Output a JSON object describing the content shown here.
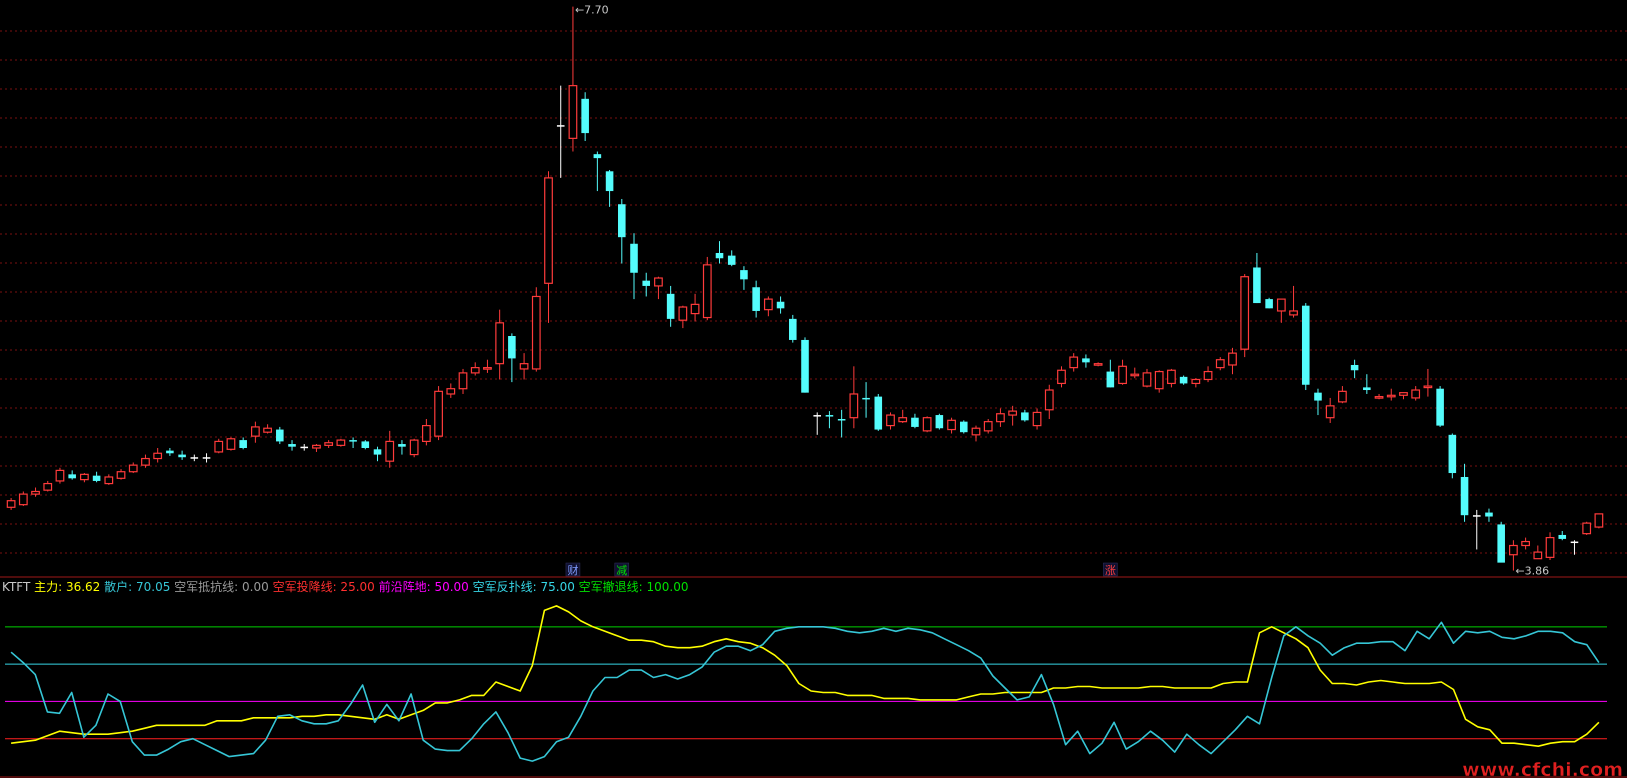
{
  "indicator": {
    "name": "KTFT",
    "items": [
      {
        "label": "主力:",
        "value": "36.62",
        "color": "#ffff00"
      },
      {
        "label": "散户:",
        "value": "70.05",
        "color": "#36c6d6"
      },
      {
        "label": "空军抵抗线:",
        "value": "0.00",
        "color": "#9a9a9a"
      },
      {
        "label": "空军投降线:",
        "value": "25.00",
        "color": "#ff3030"
      },
      {
        "label": "前沿阵地:",
        "value": "50.00",
        "color": "#ff00ff"
      },
      {
        "label": "空军反扑线:",
        "value": "75.00",
        "color": "#36d6e6"
      },
      {
        "label": "空军撤退线:",
        "value": "100.00",
        "color": "#00e000"
      }
    ]
  },
  "markers": [
    {
      "text": "财",
      "color": "#7f9cff"
    },
    {
      "text": "减",
      "color": "#00e000"
    },
    {
      "text": "涨",
      "color": "#ff4040"
    }
  ],
  "price_labels": {
    "high": "7.70",
    "low": "3.86"
  },
  "watermark": "www.cfchi.com",
  "colors": {
    "up": "#ff3b3b",
    "down": "#54fcfc",
    "doji": "#ffffff",
    "grid": "#7a1010",
    "bg": "#000000"
  },
  "chart_data": [
    {
      "type": "candlestick",
      "ylim": [
        3.5,
        7.75
      ],
      "candles": [
        [
          3.9,
          3.97,
          3.88,
          3.95
        ],
        [
          3.92,
          4.02,
          3.91,
          4.0
        ],
        [
          4.0,
          4.05,
          3.98,
          4.02
        ],
        [
          4.03,
          4.1,
          4.02,
          4.08
        ],
        [
          4.1,
          4.2,
          4.08,
          4.18
        ],
        [
          4.15,
          4.18,
          4.11,
          4.12
        ],
        [
          4.11,
          4.16,
          4.09,
          4.15
        ],
        [
          4.14,
          4.17,
          4.09,
          4.1
        ],
        [
          4.08,
          4.15,
          4.07,
          4.13
        ],
        [
          4.12,
          4.19,
          4.11,
          4.17
        ],
        [
          4.17,
          4.24,
          4.16,
          4.22
        ],
        [
          4.22,
          4.3,
          4.2,
          4.27
        ],
        [
          4.27,
          4.35,
          4.24,
          4.31
        ],
        [
          4.33,
          4.35,
          4.29,
          4.31
        ],
        [
          4.3,
          4.33,
          4.26,
          4.28
        ],
        [
          4.28,
          4.3,
          4.25,
          4.28
        ],
        [
          4.28,
          4.31,
          4.24,
          4.28
        ],
        [
          4.32,
          4.42,
          4.31,
          4.4
        ],
        [
          4.34,
          4.43,
          4.33,
          4.42
        ],
        [
          4.41,
          4.43,
          4.34,
          4.35
        ],
        [
          4.44,
          4.55,
          4.39,
          4.51
        ],
        [
          4.47,
          4.53,
          4.46,
          4.5
        ],
        [
          4.49,
          4.51,
          4.38,
          4.4
        ],
        [
          4.38,
          4.41,
          4.33,
          4.36
        ],
        [
          4.36,
          4.38,
          4.33,
          4.36
        ],
        [
          4.35,
          4.38,
          4.32,
          4.37
        ],
        [
          4.37,
          4.41,
          4.35,
          4.39
        ],
        [
          4.37,
          4.42,
          4.36,
          4.41
        ],
        [
          4.41,
          4.43,
          4.35,
          4.4
        ],
        [
          4.4,
          4.41,
          4.34,
          4.35
        ],
        [
          4.34,
          4.36,
          4.25,
          4.3
        ],
        [
          4.25,
          4.48,
          4.2,
          4.4
        ],
        [
          4.38,
          4.41,
          4.3,
          4.36
        ],
        [
          4.3,
          4.42,
          4.28,
          4.41
        ],
        [
          4.4,
          4.57,
          4.37,
          4.52
        ],
        [
          4.44,
          4.82,
          4.41,
          4.78
        ],
        [
          4.76,
          4.84,
          4.73,
          4.8
        ],
        [
          4.8,
          4.95,
          4.76,
          4.92
        ],
        [
          4.92,
          5.0,
          4.9,
          4.96
        ],
        [
          4.95,
          5.02,
          4.92,
          4.96
        ],
        [
          4.99,
          5.4,
          4.87,
          5.3
        ],
        [
          5.2,
          5.22,
          4.85,
          5.03
        ],
        [
          4.95,
          5.07,
          4.87,
          4.99
        ],
        [
          4.95,
          5.57,
          4.93,
          5.5
        ],
        [
          5.6,
          6.45,
          5.3,
          6.4
        ],
        [
          6.8,
          7.1,
          6.4,
          6.8
        ],
        [
          6.7,
          7.7,
          6.6,
          7.1
        ],
        [
          7.0,
          7.05,
          6.68,
          6.74
        ],
        [
          6.58,
          6.6,
          6.3,
          6.55
        ],
        [
          6.45,
          6.46,
          6.18,
          6.3
        ],
        [
          6.2,
          6.24,
          5.75,
          5.95
        ],
        [
          5.9,
          5.98,
          5.48,
          5.68
        ],
        [
          5.62,
          5.68,
          5.5,
          5.58
        ],
        [
          5.58,
          5.65,
          5.48,
          5.64
        ],
        [
          5.52,
          5.58,
          5.27,
          5.33
        ],
        [
          5.32,
          5.43,
          5.26,
          5.42
        ],
        [
          5.37,
          5.52,
          5.31,
          5.44
        ],
        [
          5.34,
          5.8,
          5.32,
          5.74
        ],
        [
          5.83,
          5.92,
          5.75,
          5.79
        ],
        [
          5.81,
          5.85,
          5.73,
          5.74
        ],
        [
          5.7,
          5.73,
          5.55,
          5.63
        ],
        [
          5.57,
          5.62,
          5.34,
          5.39
        ],
        [
          5.4,
          5.5,
          5.35,
          5.48
        ],
        [
          5.46,
          5.5,
          5.37,
          5.41
        ],
        [
          5.33,
          5.36,
          5.15,
          5.17
        ],
        [
          5.17,
          5.19,
          4.77,
          4.77
        ],
        [
          4.6,
          4.62,
          4.45,
          4.6
        ],
        [
          4.6,
          4.63,
          4.5,
          4.59
        ],
        [
          4.57,
          4.64,
          4.43,
          4.56
        ],
        [
          4.58,
          4.97,
          4.5,
          4.76
        ],
        [
          4.73,
          4.85,
          4.58,
          4.72
        ],
        [
          4.74,
          4.76,
          4.48,
          4.49
        ],
        [
          4.52,
          4.62,
          4.49,
          4.6
        ],
        [
          4.55,
          4.64,
          4.54,
          4.58
        ],
        [
          4.58,
          4.61,
          4.5,
          4.51
        ],
        [
          4.48,
          4.59,
          4.47,
          4.58
        ],
        [
          4.6,
          4.61,
          4.49,
          4.5
        ],
        [
          4.49,
          4.58,
          4.46,
          4.56
        ],
        [
          4.55,
          4.56,
          4.46,
          4.47
        ],
        [
          4.45,
          4.52,
          4.4,
          4.5
        ],
        [
          4.48,
          4.57,
          4.46,
          4.55
        ],
        [
          4.55,
          4.65,
          4.51,
          4.61
        ],
        [
          4.6,
          4.67,
          4.52,
          4.63
        ],
        [
          4.62,
          4.64,
          4.55,
          4.56
        ],
        [
          4.52,
          4.65,
          4.49,
          4.62
        ],
        [
          4.64,
          4.83,
          4.57,
          4.79
        ],
        [
          4.84,
          4.97,
          4.81,
          4.94
        ],
        [
          4.96,
          5.07,
          4.93,
          5.04
        ],
        [
          5.03,
          5.06,
          4.96,
          5.0
        ],
        [
          4.98,
          5.0,
          4.97,
          4.99
        ],
        [
          4.93,
          5.02,
          4.81,
          4.81
        ],
        [
          4.84,
          5.02,
          4.83,
          4.97
        ],
        [
          4.9,
          4.96,
          4.88,
          4.91
        ],
        [
          4.82,
          4.95,
          4.81,
          4.92
        ],
        [
          4.8,
          4.94,
          4.77,
          4.93
        ],
        [
          4.84,
          4.95,
          4.81,
          4.94
        ],
        [
          4.89,
          4.9,
          4.83,
          4.84
        ],
        [
          4.84,
          4.88,
          4.81,
          4.87
        ],
        [
          4.87,
          4.97,
          4.85,
          4.93
        ],
        [
          4.96,
          5.04,
          4.94,
          5.02
        ],
        [
          4.98,
          5.11,
          4.91,
          5.07
        ],
        [
          5.1,
          5.67,
          5.04,
          5.65
        ],
        [
          5.72,
          5.83,
          5.45,
          5.45
        ],
        [
          5.48,
          5.49,
          5.41,
          5.41
        ],
        [
          5.39,
          5.48,
          5.3,
          5.48
        ],
        [
          5.36,
          5.58,
          5.34,
          5.39
        ],
        [
          5.43,
          5.45,
          4.79,
          4.83
        ],
        [
          4.77,
          4.8,
          4.6,
          4.71
        ],
        [
          4.58,
          4.73,
          4.54,
          4.67
        ],
        [
          4.7,
          4.82,
          4.69,
          4.78
        ],
        [
          4.98,
          5.02,
          4.88,
          4.94
        ],
        [
          4.81,
          4.91,
          4.76,
          4.79
        ],
        [
          4.73,
          4.76,
          4.72,
          4.74
        ],
        [
          4.74,
          4.8,
          4.71,
          4.75
        ],
        [
          4.75,
          4.77,
          4.72,
          4.77
        ],
        [
          4.73,
          4.82,
          4.71,
          4.79
        ],
        [
          4.81,
          4.95,
          4.74,
          4.82
        ],
        [
          4.8,
          4.82,
          4.51,
          4.52
        ],
        [
          4.45,
          4.46,
          4.12,
          4.16
        ],
        [
          4.13,
          4.23,
          3.79,
          3.84
        ],
        [
          3.84,
          3.88,
          3.58,
          3.84
        ],
        [
          3.86,
          3.89,
          3.79,
          3.83
        ],
        [
          3.77,
          3.79,
          3.49,
          3.48
        ],
        [
          3.54,
          3.65,
          3.42,
          3.61
        ],
        [
          3.61,
          3.67,
          3.58,
          3.64
        ],
        [
          3.51,
          3.61,
          3.51,
          3.56
        ],
        [
          3.52,
          3.71,
          3.5,
          3.67
        ],
        [
          3.69,
          3.72,
          3.65,
          3.66
        ],
        [
          3.64,
          3.65,
          3.54,
          3.64
        ],
        [
          3.7,
          3.79,
          3.69,
          3.78
        ],
        [
          3.75,
          3.85,
          3.74,
          3.85
        ]
      ]
    },
    {
      "type": "line",
      "title": "KTFT",
      "ylim": [
        0,
        122
      ],
      "reference_lines": [
        {
          "name": "空军投降线",
          "value": 25,
          "color": "#ff2020"
        },
        {
          "name": "前沿阵地",
          "value": 50,
          "color": "#ff00ff"
        },
        {
          "name": "空军反扑线",
          "value": 75,
          "color": "#36d6e6"
        },
        {
          "name": "空军撤退线",
          "value": 100,
          "color": "#00d000"
        }
      ],
      "series": [
        {
          "name": "主力",
          "color": "#ffff00",
          "values": [
            22,
            23,
            24,
            27,
            30,
            29,
            28,
            28,
            28,
            29,
            30,
            32,
            34,
            34,
            34,
            34,
            34,
            37,
            37,
            37,
            39,
            39,
            39,
            39,
            40,
            40,
            41,
            41,
            40,
            39,
            38,
            41,
            38,
            41,
            44,
            49,
            49,
            51,
            54,
            54,
            63,
            60,
            57,
            74,
            111,
            114,
            110,
            104,
            100,
            97,
            94,
            91,
            91,
            90,
            87,
            86,
            86,
            87,
            90,
            92,
            90,
            89,
            86,
            81,
            74,
            62,
            57,
            56,
            56,
            54,
            54,
            54,
            52,
            52,
            52,
            51,
            51,
            51,
            51,
            53,
            55,
            55,
            56,
            56,
            56,
            56,
            59,
            59,
            60,
            60,
            59,
            59,
            59,
            59,
            60,
            60,
            59,
            59,
            59,
            59,
            62,
            63,
            63,
            96,
            100,
            96,
            92,
            86,
            71,
            62,
            62,
            61,
            63,
            64,
            63,
            62,
            62,
            62,
            63,
            58,
            38,
            33,
            31,
            22,
            22,
            21,
            20,
            22,
            23,
            23,
            28,
            36
          ]
        },
        {
          "name": "散户",
          "color": "#36c6d6",
          "values": [
            83,
            76,
            68,
            43,
            42,
            56,
            26,
            34,
            55,
            50,
            23,
            14,
            14,
            18,
            23,
            25,
            21,
            17,
            13,
            14,
            15,
            24,
            40,
            41,
            37,
            35,
            35,
            37,
            48,
            61,
            36,
            48,
            37,
            55,
            24,
            18,
            17,
            17,
            25,
            35,
            43,
            29,
            12,
            10,
            13,
            23,
            26,
            40,
            57,
            66,
            66,
            71,
            71,
            66,
            68,
            65,
            68,
            73,
            83,
            87,
            87,
            84,
            88,
            97,
            99,
            100,
            100,
            100,
            99,
            97,
            96,
            97,
            99,
            97,
            99,
            98,
            96,
            92,
            88,
            84,
            79,
            67,
            59,
            51,
            53,
            68,
            48,
            21,
            30,
            15,
            22,
            36,
            18,
            23,
            30,
            24,
            16,
            28,
            21,
            15,
            23,
            31,
            40,
            35,
            66,
            94,
            100,
            94,
            89,
            81,
            86,
            89,
            89,
            90,
            90,
            84,
            97,
            92,
            103,
            89,
            97,
            96,
            97,
            93,
            92,
            94,
            97,
            97,
            96,
            90,
            88,
            76
          ]
        }
      ]
    }
  ]
}
